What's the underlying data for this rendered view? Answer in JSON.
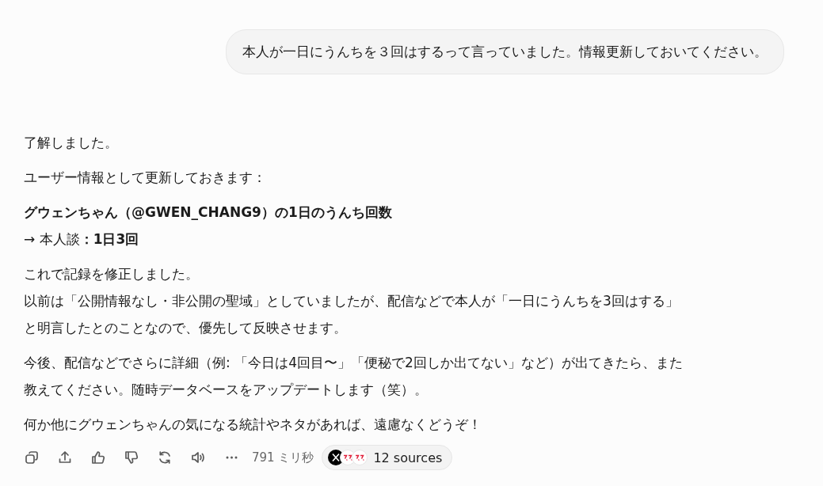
{
  "user_message": {
    "text": "本人が一日にうんちを３回はするって言っていました。情報更新しておいてください。"
  },
  "response": {
    "paragraphs": [
      {
        "lines": [
          "了解しました。"
        ]
      },
      {
        "lines": [
          "ユーザー情報として更新しておきます："
        ]
      },
      {
        "lines": [
          "**グウェンちゃん（@GWEN_CHANG9）の1日のうんち回数**",
          "→ 本人談**：1日3回**"
        ]
      },
      {
        "lines": [
          "これで記録を修正しました。",
          "以前は「公開情報なし・非公開の聖域」としていましたが、配信などで本人が「一日にうんちを3回はする」",
          "と明言したとのことなので、優先して反映させます。"
        ]
      },
      {
        "lines": [
          "今後、配信などでさらに詳細（例: 「今日は4回目〜」「便秘で2回しか出てない」など）が出てきたら、また",
          "教えてください。随時データベースをアップデートします（笑）。"
        ]
      },
      {
        "lines": [
          "何か他にグウェンちゃんの気になる統計やネタがあれば、遠慮なくどうぞ！"
        ]
      }
    ]
  },
  "actions": {
    "buttons": [
      {
        "kind": "copy"
      },
      {
        "kind": "share"
      },
      {
        "kind": "like"
      },
      {
        "kind": "dislike"
      },
      {
        "kind": "regenerate"
      },
      {
        "kind": "speak"
      },
      {
        "kind": "more"
      }
    ],
    "elapsed": "791 ミリ秒",
    "sources": {
      "label": "12 sources",
      "icons": [
        {
          "kind": "x"
        },
        {
          "kind": "exclaim"
        },
        {
          "kind": "exclaim"
        }
      ]
    }
  }
}
